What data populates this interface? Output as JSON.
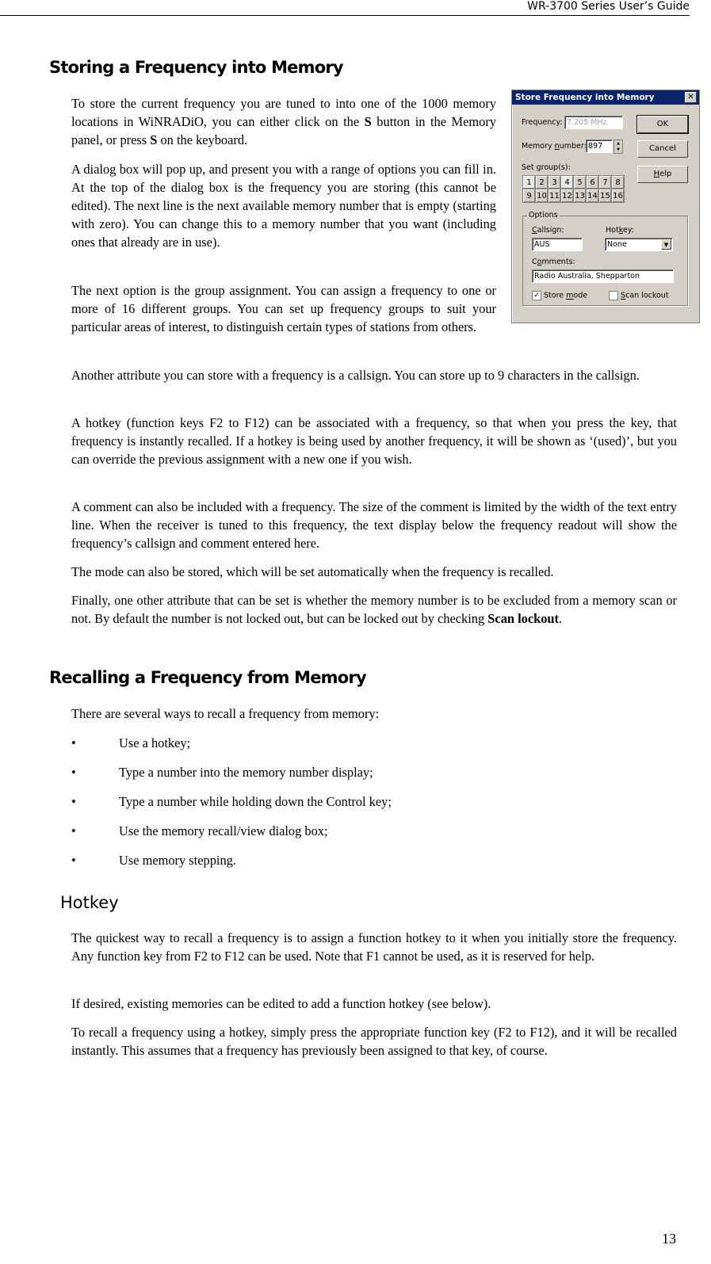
{
  "header": {
    "title": "WR-3700 Series User’s Guide"
  },
  "sections": {
    "store": {
      "heading": "Storing a Frequency into Memory",
      "paragraphs": [
        "To store the current frequency you are tuned to into one of the 1000 memory locations in WiNRADiO, you can either click on the S button in the Memory panel, or press S on the keyboard.",
        "A dialog box will pop up, and present you with a range of options you can fill in. At the top of the dialog box is the frequency you are storing (this cannot be edited). The next line is the next available memory number that is empty (starting with zero). You can change this to a memory number that you want (including ones that already are in use).",
        "The next option is the group assignment. You can assign a frequency to one or more of 16 different groups. You can set up frequency groups to suit your particular areas of interest, to distinguish certain types of stations from others.",
        "Another attribute you can store with a frequency is a callsign. You can store up to 9 characters in the callsign.",
        "A hotkey (function keys F2 to F12) can be associated with a frequency, so that when you press the key, that frequency is instantly recalled. If a hotkey is being used by another frequency, it will be shown as ‘(used)’, but you can override the previous assignment with a new one if you wish.",
        "A comment can also be included with a frequency. The size of the comment is limited by the width of the text entry line. When the receiver is tuned to this frequency, the text display below the frequency readout will show the frequency’s callsign and comment entered here.",
        "The mode can also be stored, which will be set automatically when the frequency is recalled.",
        "Finally, one other attribute that can be set is whether the memory number is to be excluded from a memory scan or not. By default the number is not locked out, but can be locked out by checking Scan lockout."
      ]
    },
    "recall": {
      "heading": "Recalling a Frequency from Memory",
      "intro": "There are several ways to recall a frequency from memory:",
      "bullet_glyph": "•",
      "bullets": [
        "Use a hotkey;",
        "Type a number into the memory number display;",
        "Type a number while holding down the Control key;",
        "Use the memory recall/view dialog box;",
        "Use memory stepping."
      ]
    },
    "hotkey": {
      "heading": "Hotkey",
      "paragraphs": [
        "The quickest way to recall a frequency is to assign a function hotkey to it when you initially store the frequency. Any function key from F2 to F12 can be used. Note that F1 cannot be used, as it is reserved for help.",
        "If desired, existing memories can be edited to add a function hotkey (see below).",
        "To recall a frequency using a hotkey, simply press the appropriate function key (F2 to F12), and it will be recalled instantly. This assumes that a frequency has previously been assigned to that key, of course."
      ]
    }
  },
  "dialog": {
    "title": "Store Frequency into Memory",
    "close_glyph": "✕",
    "frequency_label": "Frequency:",
    "frequency_value": "7.205 MHz",
    "memory_label_pre": "Memory ",
    "memory_label_u": "n",
    "memory_label_post": "umber:",
    "memory_value": "897",
    "set_groups_label": "Set group(s):",
    "groups": [
      "1",
      "2",
      "3",
      "4",
      "5",
      "6",
      "7",
      "8",
      "9",
      "10",
      "11",
      "12",
      "13",
      "14",
      "15",
      "16"
    ],
    "ok_label": "OK",
    "cancel_label": "Cancel",
    "help_u": "H",
    "help_rest": "elp",
    "options_label": "Options",
    "callsign_u": "C",
    "callsign_rest": "allsign:",
    "callsign_value": "AUS",
    "hotkey_pre": "Hot",
    "hotkey_u": "k",
    "hotkey_post": "ey:",
    "hotkey_value": "None",
    "comments_pre": "C",
    "comments_u": "o",
    "comments_post": "mments:",
    "comments_value": "Radio Australia, Shepparton",
    "store_mode_pre": "Store ",
    "store_mode_u": "m",
    "store_mode_post": "ode",
    "store_mode_checked": true,
    "scan_lockout_u": "S",
    "scan_lockout_rest": "can lockout",
    "scan_lockout_checked": false
  },
  "page_number": "13"
}
